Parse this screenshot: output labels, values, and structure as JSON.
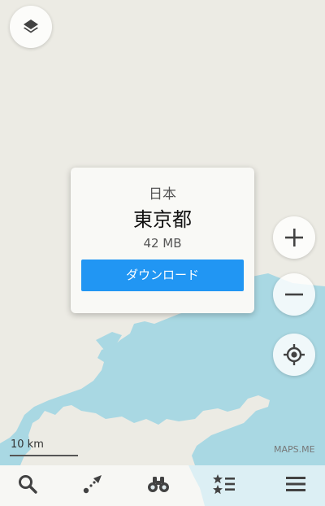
{
  "colors": {
    "land": "#ecebe4",
    "water": "#a9d8e3",
    "accent": "#2196f3",
    "icon": "#424242"
  },
  "popup": {
    "country": "日本",
    "region": "東京都",
    "size": "42 MB",
    "download_label": "ダウンロード"
  },
  "map": {
    "scale_label": "10 km",
    "attribution": "MAPS.ME"
  },
  "controls": {
    "layers_icon": "layers-icon",
    "zoom_in_icon": "plus-icon",
    "zoom_out_icon": "minus-icon",
    "my_location_icon": "crosshair-icon"
  },
  "bottom_bar": {
    "tabs": [
      {
        "icon": "search-icon"
      },
      {
        "icon": "route-icon"
      },
      {
        "icon": "binoculars-icon"
      },
      {
        "icon": "bookmarks-icon"
      },
      {
        "icon": "menu-icon"
      }
    ]
  }
}
